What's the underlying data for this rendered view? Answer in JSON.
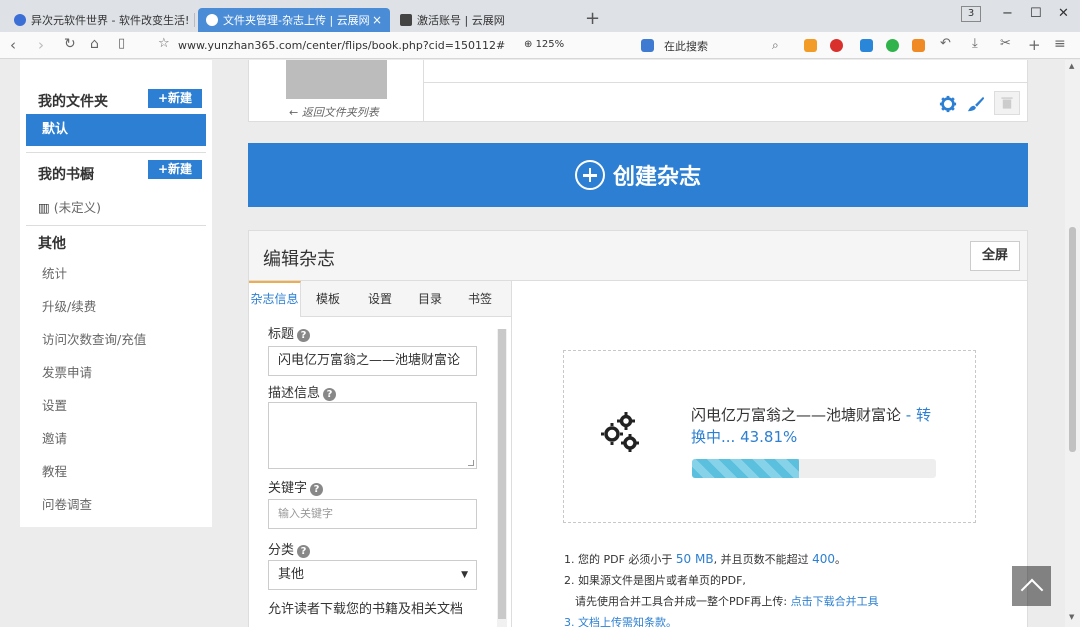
{
  "browser": {
    "tabs": [
      {
        "title": "异次元软件世界 - 软件改变生活!",
        "color": "#3b6fd6"
      },
      {
        "title": "文件夹管理-杂志上传 | 云展网",
        "color": "#ffffff"
      },
      {
        "title": "激活账号 | 云展网",
        "color": "#444444"
      }
    ],
    "window_count": "3",
    "url": "www.yunzhan365.com/center/flips/book.php?cid=150112#",
    "zoom": "125%",
    "search_placeholder": "在此搜索"
  },
  "sidebar": {
    "my_folders": "我的文件夹",
    "new_label": "+新建",
    "default_folder": "默认",
    "my_shelf": "我的书橱",
    "shelf_undefined": "(未定义)",
    "other_heading": "其他",
    "items": [
      "统计",
      "升级/续费",
      "访问次数查询/充值",
      "发票申请",
      "设置",
      "邀请",
      "教程",
      "问卷调查"
    ]
  },
  "folder": {
    "back_link": "← 返回文件夹列表"
  },
  "create_label": "创建杂志",
  "editor": {
    "title": "编辑杂志",
    "fullscreen": "全屏",
    "tabs": [
      "杂志信息",
      "模板",
      "设置",
      "目录",
      "书签"
    ],
    "title_label": "标题",
    "title_value": "闪电亿万富翁之——池塘财富论",
    "desc_label": "描述信息",
    "keywords_label": "关键字",
    "keywords_placeholder": "输入关键字",
    "category_label": "分类",
    "category_value": "其他",
    "allow_download": "允许读者下载您的书籍及相关文档"
  },
  "conversion": {
    "name": "闪电亿万富翁之——池塘财富论",
    "status": " - 转换中... 43.81%",
    "progress": 0.4381
  },
  "notes": {
    "n1_pre": "1. 您的 PDF 必须小于 ",
    "n1_size": "50 MB",
    "n1_mid": ", 并且页数不能超过 ",
    "n1_pages": "400",
    "n1_end": "。",
    "n2": "2. 如果源文件是图片或者单页的PDF,",
    "n2b": "请先使用合并工具合并成一整个PDF再上传: ",
    "n2_link": "点击下载合并工具",
    "n3": "3. 文档上传需知条款。"
  }
}
